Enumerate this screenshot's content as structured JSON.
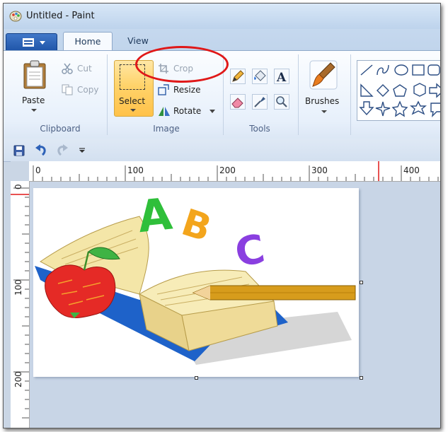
{
  "window": {
    "title": "Untitled - Paint"
  },
  "tabs": [
    {
      "label": "Home",
      "active": true
    },
    {
      "label": "View",
      "active": false
    }
  ],
  "ribbon": {
    "clipboard": {
      "group_label": "Clipboard",
      "paste_label": "Paste",
      "cut_label": "Cut",
      "copy_label": "Copy"
    },
    "image": {
      "group_label": "Image",
      "select_label": "Select",
      "crop_label": "Crop",
      "resize_label": "Resize",
      "rotate_label": "Rotate"
    },
    "tools": {
      "group_label": "Tools"
    },
    "brushes": {
      "label": "Brushes"
    }
  },
  "ruler": {
    "h_labels": [
      "0",
      "100",
      "200",
      "300",
      "400"
    ],
    "v_labels": [
      "0",
      "100",
      "200"
    ]
  },
  "canvas": {
    "letters": [
      "A",
      "B",
      "C"
    ]
  },
  "colors": {
    "accent": "#1f55a8",
    "highlight": "#e01818",
    "select_active": "#ffd36a"
  }
}
